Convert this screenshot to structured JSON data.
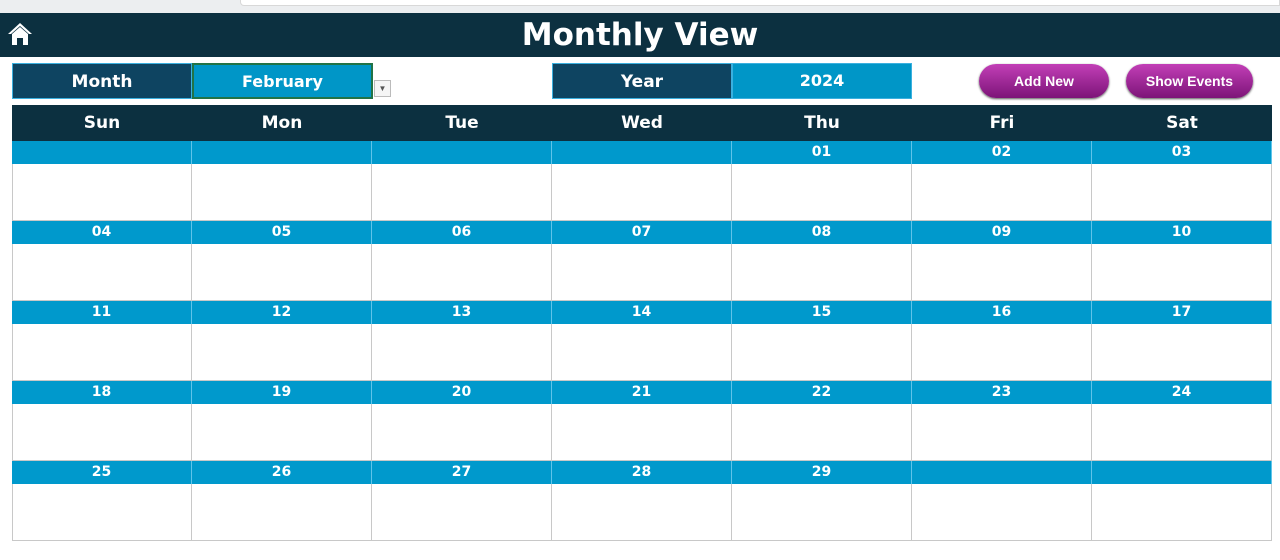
{
  "header": {
    "title": "Monthly View",
    "home_icon": "home-icon"
  },
  "controls": {
    "month_label": "Month",
    "month_value": "February",
    "year_label": "Year",
    "year_value": "2024",
    "add_new": "Add New",
    "show_events": "Show Events",
    "button_color": "#a0289a"
  },
  "calendar": {
    "days": [
      "Sun",
      "Mon",
      "Tue",
      "Wed",
      "Thu",
      "Fri",
      "Sat"
    ],
    "weeks": [
      [
        "",
        "",
        "",
        "",
        "01",
        "02",
        "03"
      ],
      [
        "04",
        "05",
        "06",
        "07",
        "08",
        "09",
        "10"
      ],
      [
        "11",
        "12",
        "13",
        "14",
        "15",
        "16",
        "17"
      ],
      [
        "18",
        "19",
        "20",
        "21",
        "22",
        "23",
        "24"
      ],
      [
        "25",
        "26",
        "27",
        "28",
        "29",
        "",
        ""
      ]
    ]
  }
}
